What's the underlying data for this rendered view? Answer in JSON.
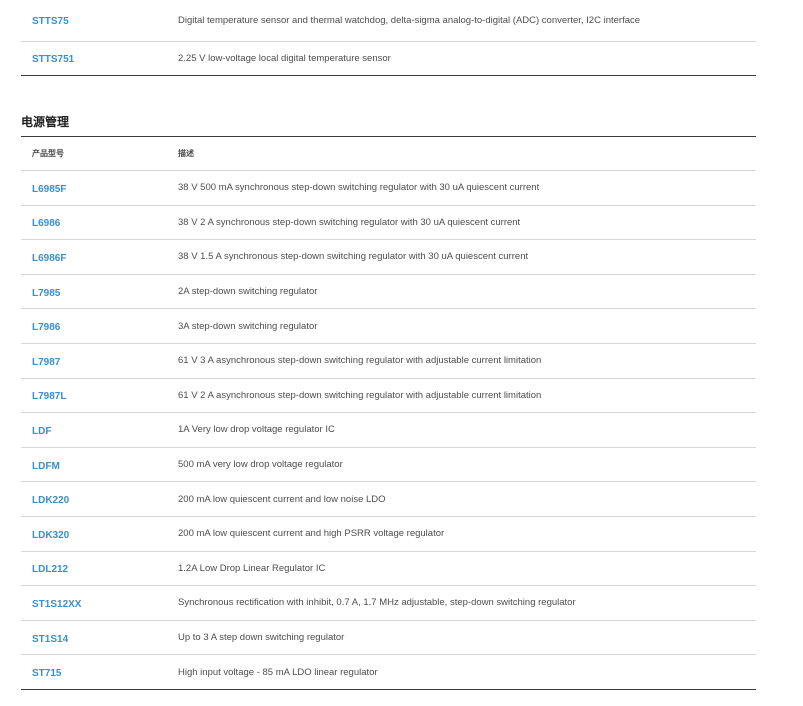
{
  "top_table": {
    "rows": [
      {
        "part": "STTS75",
        "desc": "Digital temperature sensor and thermal watchdog, delta-sigma analog-to-digital (ADC) converter, I2C interface"
      },
      {
        "part": "STTS751",
        "desc": "2.25 V low-voltage local digital temperature sensor"
      }
    ]
  },
  "power_section": {
    "title": "电源管理",
    "headers": {
      "part": "产品型号",
      "desc": "描述"
    },
    "rows": [
      {
        "part": "L6985F",
        "desc": "38 V 500 mA synchronous step-down switching regulator with 30 uA quiescent current"
      },
      {
        "part": "L6986",
        "desc": "38 V 2 A synchronous step-down switching regulator with 30 uA quiescent current"
      },
      {
        "part": "L6986F",
        "desc": "38 V 1.5 A synchronous step-down switching regulator with 30 uA quiescent current"
      },
      {
        "part": "L7985",
        "desc": "2A step-down switching regulator"
      },
      {
        "part": "L7986",
        "desc": "3A step-down switching regulator"
      },
      {
        "part": "L7987",
        "desc": "61 V 3 A asynchronous step-down switching regulator with adjustable current limitation"
      },
      {
        "part": "L7987L",
        "desc": "61 V 2 A asynchronous step-down switching regulator with adjustable current limitation"
      },
      {
        "part": "LDF",
        "desc": "1A Very low drop voltage regulator IC"
      },
      {
        "part": "LDFM",
        "desc": "500 mA very low drop voltage regulator"
      },
      {
        "part": "LDK220",
        "desc": "200 mA low quiescent current and low noise LDO"
      },
      {
        "part": "LDK320",
        "desc": "200 mA low quiescent current and high PSRR voltage regulator"
      },
      {
        "part": "LDL212",
        "desc": "1.2A Low Drop Linear Regulator IC"
      },
      {
        "part": "ST1S12XX",
        "desc": "Synchronous rectification with inhibit, 0.7 A, 1.7 MHz adjustable, step-down switching regulator"
      },
      {
        "part": "ST1S14",
        "desc": "Up to 3 A step down switching regulator"
      },
      {
        "part": "ST715",
        "desc": "High input voltage - 85 mA LDO linear regulator"
      }
    ]
  },
  "colors": {
    "link": "#3a8fcf",
    "rule_dark": "#3b3b3b",
    "rule_light": "#d7d7d7"
  }
}
